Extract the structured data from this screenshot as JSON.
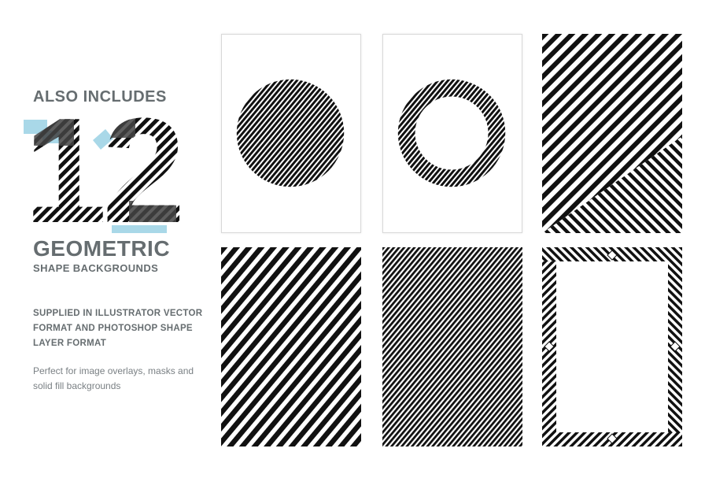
{
  "heading": {
    "also_includes": "ALSO INCLUDES",
    "number": "12",
    "geometric": "GEOMETRIC",
    "shape_backgrounds": "SHAPE BACKGROUNDS"
  },
  "details": {
    "supplied": "SUPPLIED IN ILLUSTRATOR VECTOR FORMAT AND PHOTOSHOP SHAPE LAYER FORMAT",
    "perfect": "Perfect for image overlays, masks and solid fill backgrounds"
  },
  "colors": {
    "text": "#666d70",
    "accent": "#a9d8e8",
    "stripe": "#111111"
  },
  "backgrounds": [
    {
      "id": "circle-fill",
      "pattern": "striped filled circle"
    },
    {
      "id": "ring",
      "pattern": "striped ring"
    },
    {
      "id": "split-diagonal",
      "pattern": "opposing diagonal stripes"
    },
    {
      "id": "thick-diagonal",
      "pattern": "thick diagonal stripes"
    },
    {
      "id": "thin-diagonal",
      "pattern": "thin diagonal stripes"
    },
    {
      "id": "frame",
      "pattern": "striped frame border"
    }
  ]
}
